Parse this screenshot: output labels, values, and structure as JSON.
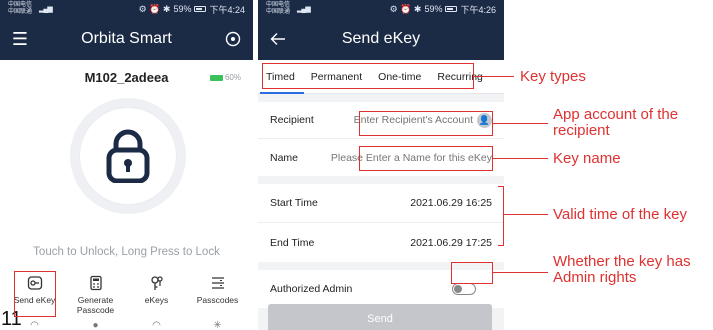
{
  "status_bar": {
    "carrier": "中国电信 中国联通",
    "left_time_icons": "⚙ ⏰ ✱",
    "battery": "59%",
    "time_left": "下午4:24",
    "time_right": "下午4:26"
  },
  "screen_home": {
    "title": "Orbita Smart",
    "lock_name": "M102_2adeea",
    "battery_level": "60%",
    "hint": "Touch to Unlock, Long Press to Lock",
    "tools": [
      {
        "label": "Send eKey",
        "icon": "key-send-icon"
      },
      {
        "label": "Generate Passcode",
        "icon": "calculator-icon"
      },
      {
        "label": "eKeys",
        "icon": "keys-icon"
      },
      {
        "label": "Passcodes",
        "icon": "list-icon"
      }
    ]
  },
  "screen_send": {
    "title": "Send eKey",
    "tabs": [
      "Timed",
      "Permanent",
      "One-time",
      "Recurring"
    ],
    "recipient_label": "Recipient",
    "recipient_placeholder": "Enter Recipient's Account",
    "name_label": "Name",
    "name_placeholder": "Please Enter a Name for this eKey",
    "start_label": "Start Time",
    "start_value": "2021.06.29 16:25",
    "end_label": "End Time",
    "end_value": "2021.06.29 17:25",
    "admin_label": "Authorized Admin",
    "admin_enabled": false,
    "send_label": "Send"
  },
  "annotations": {
    "key_types": "Key types",
    "app_account": "App account of the recipient",
    "key_name": "Key name",
    "valid_time": "Valid time of the key",
    "admin_rights": "Whether the key has Admin rights"
  },
  "page_number": "11",
  "colors": {
    "header": "#1b2a45",
    "annotation": "#e03131",
    "accent": "#2d6cdf",
    "battery": "#3bc15a"
  }
}
